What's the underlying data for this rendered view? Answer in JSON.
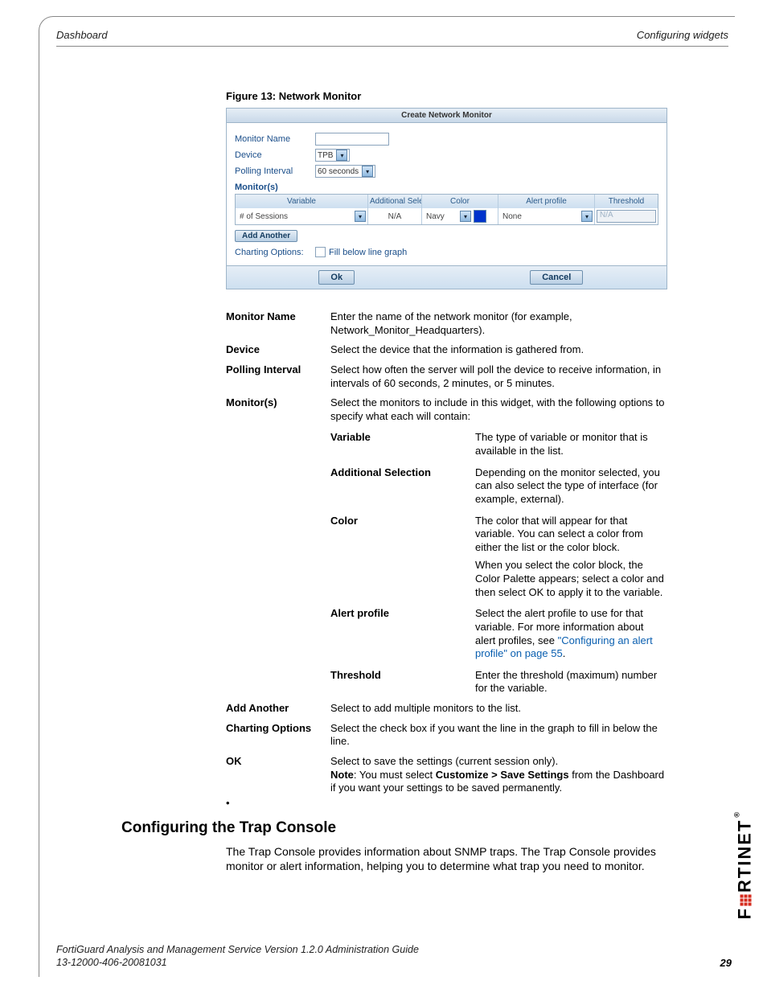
{
  "header": {
    "left": "Dashboard",
    "right": "Configuring widgets"
  },
  "figure": {
    "caption": "Figure 13: Network Monitor",
    "dialog_title": "Create Network Monitor",
    "labels": {
      "monitor_name": "Monitor Name",
      "device": "Device",
      "polling_interval": "Polling Interval",
      "monitors": "Monitor(s)"
    },
    "values": {
      "device": "TPB",
      "polling": "60 seconds"
    },
    "columns": {
      "variable": "Variable",
      "addsel": "Additional Selection",
      "color": "Color",
      "alert": "Alert profile",
      "threshold": "Threshold"
    },
    "row1": {
      "variable": "# of Sessions",
      "addsel": "N/A",
      "color": "Navy",
      "alert": "None",
      "threshold": "N/A"
    },
    "add_another": "Add Another",
    "charting_label": "Charting Options:",
    "charting_text": "Fill below line graph",
    "ok": "Ok",
    "cancel": "Cancel"
  },
  "defs": {
    "monitor_name": {
      "label": "Monitor Name",
      "text": "Enter the name of the network monitor (for example, Network_Monitor_Headquarters)."
    },
    "device": {
      "label": "Device",
      "text": "Select the device that the information is gathered from."
    },
    "polling": {
      "label": "Polling Interval",
      "text": "Select how often the server will poll the device to receive information, in intervals of 60 seconds, 2 minutes, or 5 minutes."
    },
    "monitors": {
      "label": "Monitor(s)",
      "text": "Select the monitors to include in this widget, with the following options to specify what each will contain:"
    },
    "variable": {
      "label": "Variable",
      "text": "The type of variable or monitor that is available in the list."
    },
    "addsel": {
      "label": "Additional Selection",
      "text": "Depending on the monitor selected, you can also select the type of interface (for example, external)."
    },
    "color": {
      "label": "Color",
      "text1": "The color that will appear for that variable. You can select a color from either the list or the color block.",
      "text2": "When you select the color block, the Color Palette appears; select a color and then select OK to apply it to the variable."
    },
    "alert": {
      "label": "Alert profile",
      "text_a": "Select the alert profile to use for that variable. For more information about alert profiles, see ",
      "link": "\"Configuring an alert profile\" on page 55",
      "text_b": "."
    },
    "threshold": {
      "label": "Threshold",
      "text": "Enter the threshold (maximum) number for the variable."
    },
    "add_another": {
      "label": "Add Another",
      "text": "Select to add multiple monitors to the list."
    },
    "charting": {
      "label": "Charting Options",
      "text": "Select the check box if you want the line in the graph to fill in below the line."
    },
    "ok": {
      "label": "OK",
      "text_a": "Select to save the settings (current session only).",
      "note_label": "Note",
      "note_mid": ": You must select ",
      "note_bold": "Customize > Save Settings",
      "note_end": " from the Dashboard if you want your settings to be saved permanently."
    }
  },
  "bullet": "•",
  "section": {
    "heading": "Configuring the Trap Console",
    "body": "The Trap Console provides information about SNMP traps. The Trap Console provides monitor or alert information, helping you to determine what trap you need to monitor."
  },
  "footer": {
    "line1": "FortiGuard Analysis and Management Service Version 1.2.0 Administration Guide",
    "line2": "13-12000-406-20081031",
    "page": "29"
  },
  "brand": {
    "pre": "F",
    "post": "RTINET",
    "tm": "®"
  }
}
